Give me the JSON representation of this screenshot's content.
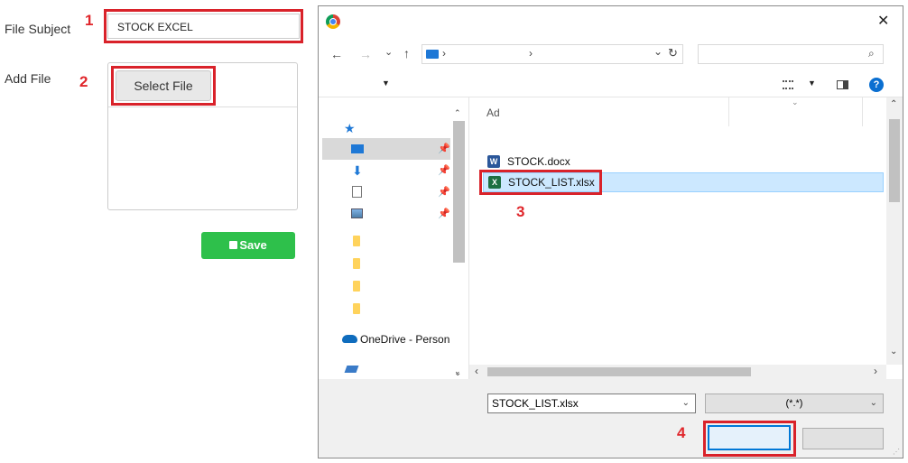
{
  "form": {
    "subject_label": "File Subject",
    "subject_value": "STOCK EXCEL",
    "add_file_label": "Add File",
    "select_file_label": "Select File",
    "save_label": "Save"
  },
  "steps": [
    "1",
    "2",
    "3",
    "4"
  ],
  "dialog": {
    "close_glyph": "✕",
    "column_header": "Ad",
    "files": [
      {
        "name": "STOCK.docx",
        "type": "word"
      },
      {
        "name": "STOCK_LIST.xlsx",
        "type": "excel"
      }
    ],
    "sidebar_onedrive": "OneDrive - Person",
    "file_name_value": "STOCK_LIST.xlsx",
    "file_type_value": "(*.*)"
  },
  "colors": {
    "step_red": "#d9222a",
    "save_green": "#2ec04b",
    "selection_blue": "#cce8ff",
    "accent_blue": "#0078d7"
  }
}
